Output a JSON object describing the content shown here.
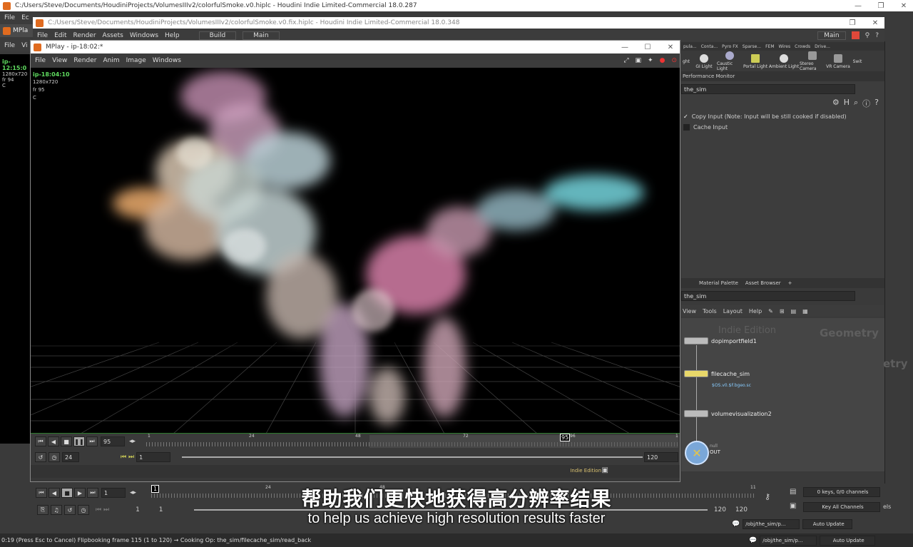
{
  "back_window": {
    "title": "C:/Users/Steve/Documents/HoudiniProjects/VolumesIIIv2/colorfulSmoke.v0.hiplc - Houdini Indie Limited-Commercial 18.0.287"
  },
  "mid_window": {
    "title": "C:/Users/Steve/Documents/HoudiniProjects/VolumesIIIv2/colorfulSmoke.v0.fix.hiplc - Houdini Indie Limited-Commercial 18.0.348",
    "menu": [
      "File",
      "Edit",
      "Render",
      "Assets",
      "Windows",
      "Help"
    ],
    "build": "Build",
    "main": "Main",
    "back_menu": [
      "File",
      "Ec"
    ],
    "left_menu": [
      "File",
      "Vi"
    ],
    "left_tab": "MPla"
  },
  "left_info": {
    "id": "ip-12:15:0",
    "res": "1280x720",
    "fr": "fr 94",
    "c": "C"
  },
  "shelf": {
    "desk": "Main",
    "tabs": [
      "pula...",
      "Conta...",
      "Pyro FX",
      "Sparse...",
      "FEM",
      "Wires",
      "Crowds",
      "Drive..."
    ],
    "tools": [
      "ght",
      "GI Light",
      "Caustic Light",
      "Portal Light",
      "Ambient Light",
      "Stereo Camera",
      "VR Camera",
      "Swit"
    ]
  },
  "params": {
    "tab": "Performance Monitor",
    "path": "the_sim",
    "copy_input": "Copy Input (Note: Input will be still cooked if disabled)",
    "cache_input": "Cache Input"
  },
  "network": {
    "tabs": [
      "Material Palette",
      "Asset Browser"
    ],
    "path": "the_sim",
    "menu": [
      "View",
      "Tools",
      "Layout",
      "Help"
    ],
    "watermark": "Indie Edition",
    "context": "Geometry",
    "context2": "etry",
    "nodes": [
      {
        "name": "dopimportfield1",
        "sub": ""
      },
      {
        "name": "filecache_sim",
        "sub": "$OS.v0.$F.bgeo.sc"
      },
      {
        "name": "volumevisualization2",
        "sub": ""
      },
      {
        "name": "OUT",
        "sub": "null"
      }
    ]
  },
  "mplay": {
    "title": "MPlay - ip-18:02:*",
    "menu": [
      "File",
      "View",
      "Render",
      "Anim",
      "Image",
      "Windows"
    ],
    "info": {
      "id": "ip-18:04:10",
      "res": "1280x720",
      "fr": "fr 95",
      "c": "C"
    },
    "frame": "95",
    "fps": "24",
    "start": "1",
    "end": "120",
    "ticks": [
      "1",
      "24",
      "48",
      "72",
      "95",
      "96",
      "1"
    ],
    "watermark": "Indie Edition"
  },
  "timeline": {
    "frame": "1",
    "ticks": [
      "1",
      "24",
      "48",
      "11"
    ],
    "start": "1",
    "start2": "1",
    "end": "120",
    "end2": "120",
    "keys": "0 keys, 0/0 channels",
    "key_all": "Key All Channels",
    "path1": "/obj/the_sim/p...",
    "path2": "/obj/the_sim/p...",
    "auto1": "Auto Update",
    "auto2": "Auto Update",
    "els": "els"
  },
  "subtitle": {
    "cn": "帮助我们更快地获得高分辨率结果",
    "en": "to help us achieve high resolution results faster"
  },
  "status": "0:19 (Press Esc to Cancel) Flipbooking frame 115 (1 to 120) → Cooking Op:  the_sim/filecache_sim/read_back",
  "colors": {
    "accent": "#e06b1f",
    "smoke_pink": "#d67fa8",
    "smoke_cyan": "#6ec9d0",
    "smoke_orange": "#e0a060"
  }
}
